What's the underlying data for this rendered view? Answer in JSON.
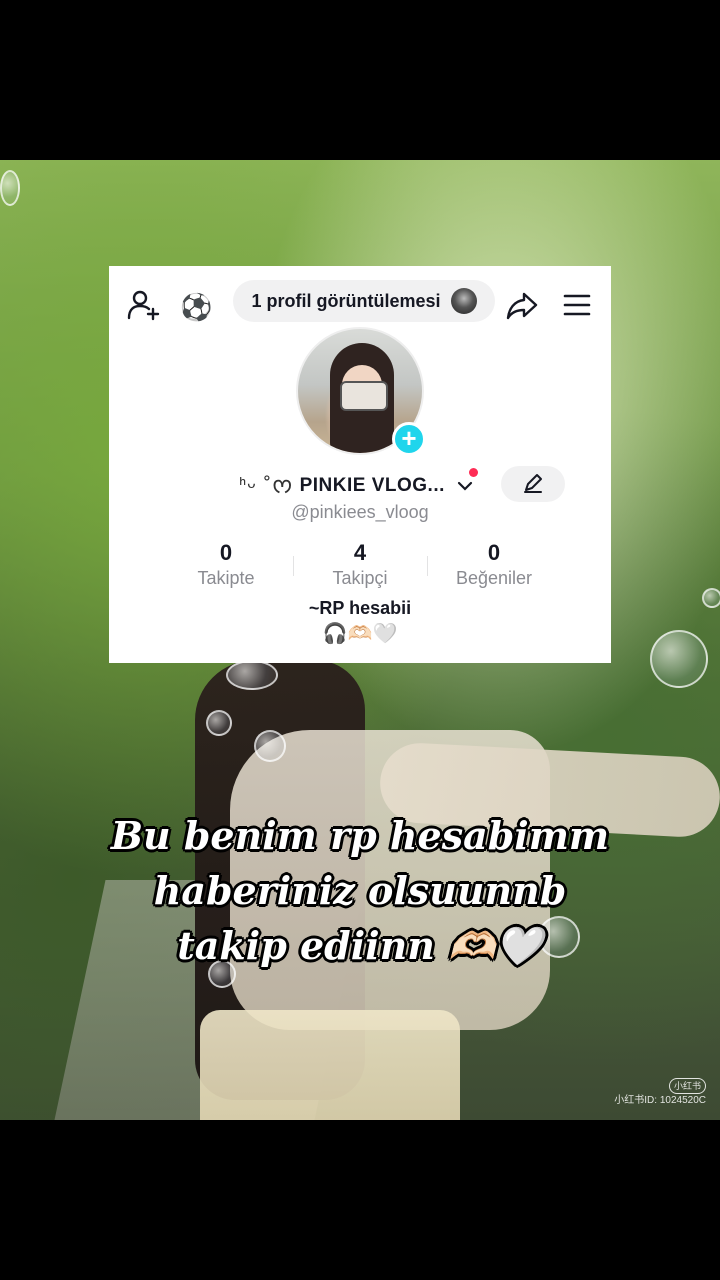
{
  "profile_card": {
    "views_text": "1 profil görüntülemesi",
    "display_name": "PINKIE VLOG...",
    "name_decoration": "ᑋᵕ ˚ᰔ",
    "handle": "@pinkiees_vloog",
    "stats": [
      {
        "value": "0",
        "label": "Takipte"
      },
      {
        "value": "4",
        "label": "Takipçi"
      },
      {
        "value": "0",
        "label": "Beğeniler"
      }
    ],
    "bio_line1": "~RP hesabii",
    "bio_line2": "🎧🫶🏻🤍",
    "plus_symbol": "+",
    "ball_emoji": "⚽"
  },
  "caption": {
    "line1": "Bu benim rp hesabimm",
    "line2": "haberiniz olsuunnb",
    "line3": "takip ediinn 🫶🏻🤍"
  },
  "watermark": {
    "logo": "小红书",
    "id_text": "小红书ID: 1024520C"
  },
  "colors": {
    "accent_cyan": "#20d5ec",
    "notification_red": "#fe2c55",
    "text_primary": "#161823",
    "text_secondary": "#8a8b91"
  }
}
